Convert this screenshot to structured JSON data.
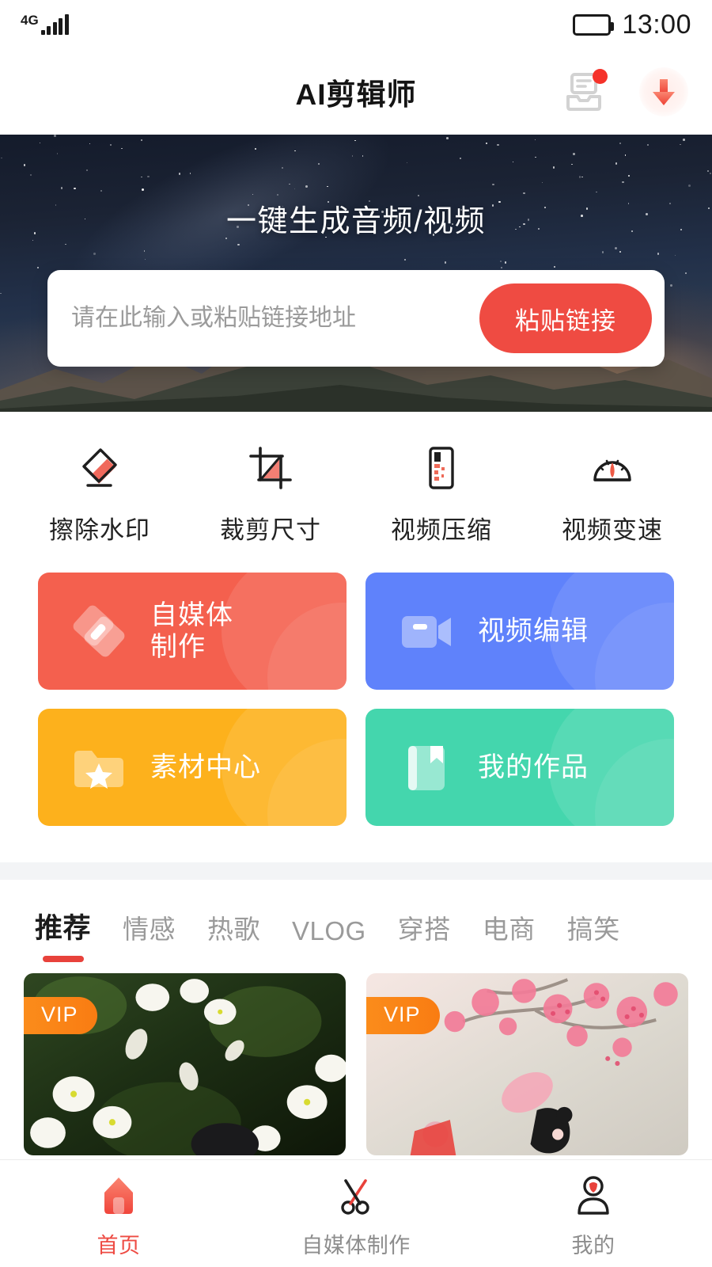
{
  "status_bar": {
    "network": "4G",
    "signal_icon": "signal-bars-icon",
    "battery_icon": "battery-full-icon",
    "time": "13:00"
  },
  "header": {
    "title": "AI剪辑师",
    "inbox_icon": "inbox-message-icon",
    "inbox_has_badge": true,
    "download_icon": "download-arrow-icon"
  },
  "banner": {
    "title": "一键生成音频/视频",
    "input_value": "",
    "input_placeholder": "请在此输入或粘贴链接地址",
    "paste_button_label": "粘贴链接",
    "background": "starry-night-mountain-photo"
  },
  "quick_actions": [
    {
      "label": "擦除水印",
      "icon": "eraser-icon"
    },
    {
      "label": "裁剪尺寸",
      "icon": "crop-icon"
    },
    {
      "label": "视频压缩",
      "icon": "video-compress-icon"
    },
    {
      "label": "视频变速",
      "icon": "speedometer-icon"
    }
  ],
  "feature_cards": [
    {
      "label": "自媒体\n制作",
      "icon": "rhombus-media-icon",
      "color": "#F4604E",
      "name": "self-media-production"
    },
    {
      "label": "视频编辑",
      "icon": "video-camera-icon",
      "color": "#5F82FB",
      "name": "video-editing"
    },
    {
      "label": "素材中心",
      "icon": "folder-star-icon",
      "color": "#FDB11C",
      "name": "material-center"
    },
    {
      "label": "我的作品",
      "icon": "bookmark-icon",
      "color": "#44D6AD",
      "name": "my-works"
    }
  ],
  "tabs": {
    "active_index": 0,
    "items": [
      "推荐",
      "情感",
      "热歌",
      "VLOG",
      "穿搭",
      "电商",
      "搞笑"
    ]
  },
  "videos": [
    {
      "badge": "VIP",
      "thumb": "white-cherry-blossom-dark-green"
    },
    {
      "badge": "VIP",
      "thumb": "pink-cherry-blossom-illustration"
    }
  ],
  "bottom_nav": {
    "active_index": 0,
    "items": [
      {
        "label": "首页",
        "icon": "home-icon"
      },
      {
        "label": "自媒体制作",
        "icon": "scissors-icon"
      },
      {
        "label": "我的",
        "icon": "user-profile-icon"
      }
    ]
  },
  "colors": {
    "accent_red": "#EF4B42",
    "tab_underline": "#E8423B",
    "vip_orange": "#F97C12",
    "divider_gray": "#F3F4F6"
  }
}
